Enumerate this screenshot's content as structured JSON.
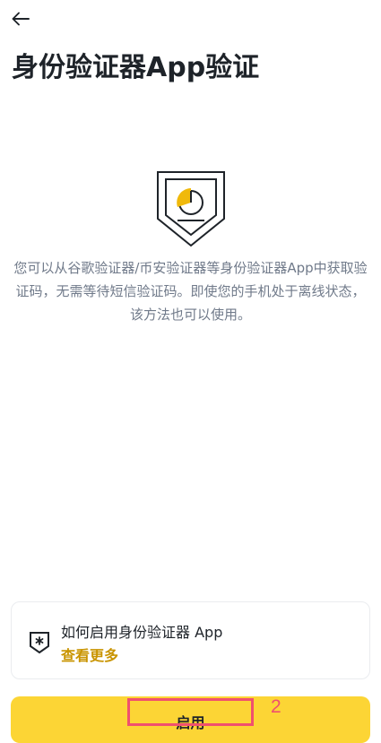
{
  "header": {
    "back_icon": "arrow-left-icon",
    "title": "身份验证器App验证"
  },
  "hero": {
    "icon": "authenticator-shield-icon",
    "accent_color": "#F0B90B",
    "description": "您可以从谷歌验证器/币安验证器等身份验证器App中获取验证码，无需等待短信验证码。即使您的手机处于离线状态，该方法也可以使用。"
  },
  "help_card": {
    "icon": "authenticator-app-icon",
    "title": "如何启用身份验证器 App",
    "link_label": "查看更多",
    "link_color": "#C99400"
  },
  "primary_button": {
    "label": "启用",
    "background": "#FCD535"
  },
  "annotation": {
    "number": "2",
    "color": "#F0506E"
  }
}
